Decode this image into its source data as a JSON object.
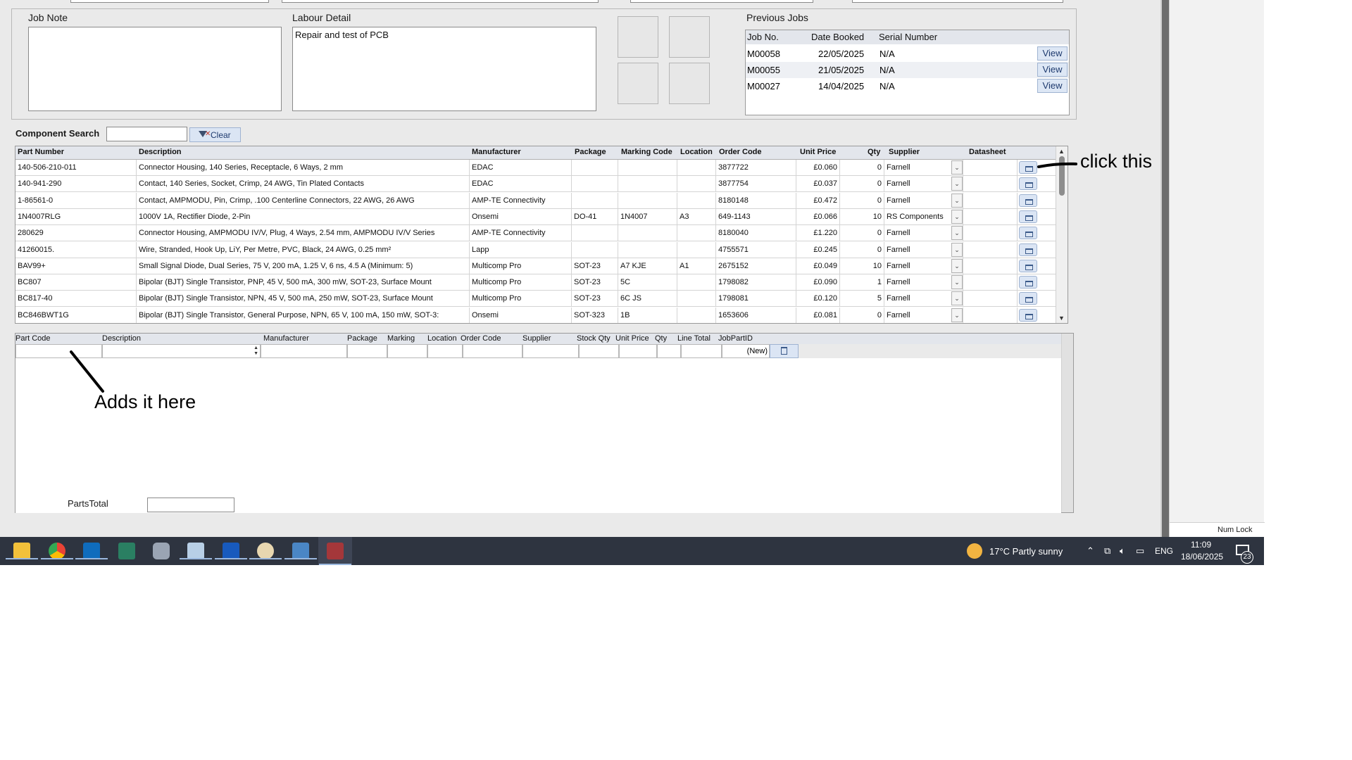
{
  "job_note": {
    "label": "Job Note",
    "value": ""
  },
  "labour_detail": {
    "label": "Labour Detail",
    "value": "Repair and test of PCB"
  },
  "previous_jobs": {
    "label": "Previous Jobs",
    "columns": [
      "Job No.",
      "Date Booked",
      "Serial Number"
    ],
    "rows": [
      {
        "job_no": "M00058",
        "date": "22/05/2025",
        "serial": "N/A",
        "action": "View"
      },
      {
        "job_no": "M00055",
        "date": "21/05/2025",
        "serial": "N/A",
        "action": "View"
      },
      {
        "job_no": "M00027",
        "date": "14/04/2025",
        "serial": "N/A",
        "action": "View"
      }
    ]
  },
  "component_search": {
    "label": "Component Search",
    "value": "",
    "clear_label": "Clear"
  },
  "components": {
    "columns": [
      "Part Number",
      "Description",
      "Manufacturer",
      "Package",
      "Marking Code",
      "Location",
      "Order Code",
      "Unit Price",
      "Qty",
      "Supplier",
      "Datasheet"
    ],
    "rows": [
      {
        "part": "140-506-210-011",
        "desc": "Connector Housing, 140 Series, Receptacle, 6 Ways, 2 mm",
        "mfr": "EDAC",
        "pkg": "",
        "mark": "",
        "loc": "",
        "order": "3877722",
        "price": "£0.060",
        "qty": "0",
        "supplier": "Farnell"
      },
      {
        "part": "140-941-290",
        "desc": "Contact, 140 Series, Socket, Crimp, 24 AWG, Tin Plated Contacts",
        "mfr": "EDAC",
        "pkg": "",
        "mark": "",
        "loc": "",
        "order": "3877754",
        "price": "£0.037",
        "qty": "0",
        "supplier": "Farnell"
      },
      {
        "part": "1-86561-0",
        "desc": "Contact, AMPMODU, Pin, Crimp, .100 Centerline Connectors, 22 AWG, 26 AWG",
        "mfr": "AMP-TE Connectivity",
        "pkg": "",
        "mark": "",
        "loc": "",
        "order": "8180148",
        "price": "£0.472",
        "qty": "0",
        "supplier": "Farnell"
      },
      {
        "part": "1N4007RLG",
        "desc": "1000V 1A, Rectifier Diode, 2-Pin",
        "mfr": "Onsemi",
        "pkg": "DO-41",
        "mark": "1N4007",
        "loc": "A3",
        "order": "649-1143",
        "price": "£0.066",
        "qty": "10",
        "supplier": "RS Components"
      },
      {
        "part": "280629",
        "desc": "Connector Housing, AMPMODU IV/V, Plug, 4 Ways, 2.54 mm, AMPMODU IV/V Series",
        "mfr": "AMP-TE Connectivity",
        "pkg": "",
        "mark": "",
        "loc": "",
        "order": "8180040",
        "price": "£1.220",
        "qty": "0",
        "supplier": "Farnell"
      },
      {
        "part": "41260015.",
        "desc": "Wire, Stranded, Hook Up, LiY, Per Metre, PVC, Black, 24 AWG, 0.25 mm²",
        "mfr": "Lapp",
        "pkg": "",
        "mark": "",
        "loc": "",
        "order": "4755571",
        "price": "£0.245",
        "qty": "0",
        "supplier": "Farnell"
      },
      {
        "part": "BAV99+",
        "desc": "Small Signal Diode, Dual Series, 75 V, 200 mA, 1.25 V, 6 ns, 4.5 A (Minimum: 5)",
        "mfr": "Multicomp Pro",
        "pkg": "SOT-23",
        "mark": "A7 KJE",
        "loc": "A1",
        "order": "2675152",
        "price": "£0.049",
        "qty": "10",
        "supplier": "Farnell"
      },
      {
        "part": "BC807",
        "desc": "Bipolar (BJT) Single Transistor, PNP, 45 V, 500 mA, 300 mW, SOT-23, Surface Mount",
        "mfr": "Multicomp Pro",
        "pkg": "SOT-23",
        "mark": "5C",
        "loc": "",
        "order": "1798082",
        "price": "£0.090",
        "qty": "1",
        "supplier": "Farnell"
      },
      {
        "part": "BC817-40",
        "desc": "Bipolar (BJT) Single Transistor, NPN, 45 V, 500 mA, 250 mW, SOT-23, Surface Mount",
        "mfr": "Multicomp Pro",
        "pkg": "SOT-23",
        "mark": "6C JS",
        "loc": "",
        "order": "1798081",
        "price": "£0.120",
        "qty": "5",
        "supplier": "Farnell"
      },
      {
        "part": "BC846BWT1G",
        "desc": "Bipolar (BJT) Single Transistor, General Purpose, NPN, 65 V, 100 mA, 150 mW, SOT-3:",
        "mfr": "Onsemi",
        "pkg": "SOT-323",
        "mark": "1B",
        "loc": "",
        "order": "1653606",
        "price": "£0.081",
        "qty": "0",
        "supplier": "Farnell"
      }
    ]
  },
  "parts": {
    "columns": [
      "Part Code",
      "Description",
      "Manufacturer",
      "Package",
      "Marking",
      "Location",
      "Order Code",
      "Supplier",
      "Stock Qty",
      "Unit Price",
      "Qty",
      "Line Total",
      "JobPartID"
    ],
    "new_row_label": "(New)",
    "total_label": "PartsTotal",
    "total_value": ""
  },
  "annotations": {
    "click_this": "click this",
    "adds_it_here": "Adds it here"
  },
  "taskbar": {
    "weather": "17°C  Partly sunny",
    "language": "ENG",
    "time": "11:09",
    "date": "18/06/2025",
    "notifications": "23",
    "num_lock": "Num Lock"
  }
}
